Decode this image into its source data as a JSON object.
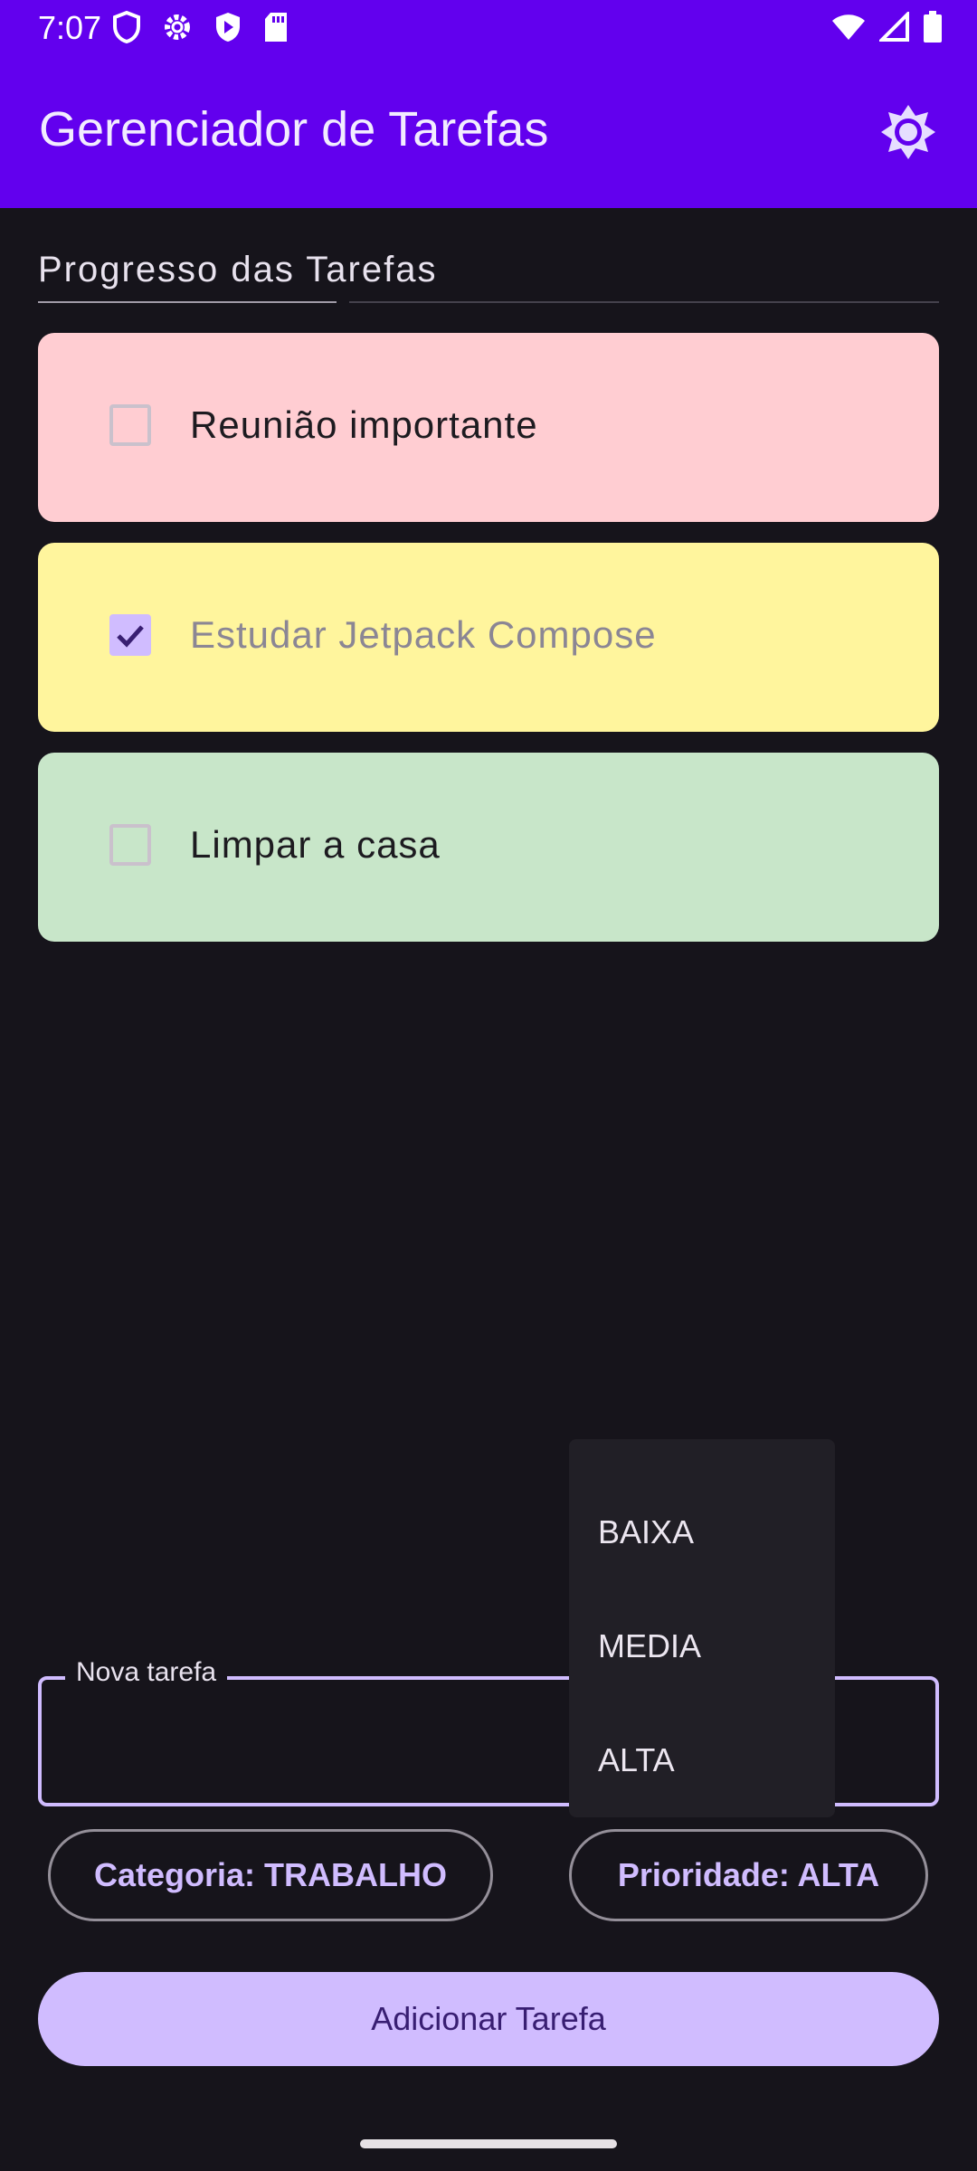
{
  "status_bar": {
    "time": "7:07",
    "icons_left": [
      "shield-icon",
      "gear-icon",
      "play-protect-icon",
      "sd-card-icon"
    ],
    "icons_right": [
      "wifi-icon",
      "signal-icon",
      "battery-icon"
    ]
  },
  "app_bar": {
    "title": "Gerenciador de Tarefas",
    "settings_icon": "brightness-icon"
  },
  "progress": {
    "title": "Progresso das Tarefas",
    "value": 0.33
  },
  "tasks": [
    {
      "label": "Reunião importante",
      "checked": false,
      "color": "#ffcdd2"
    },
    {
      "label": "Estudar Jetpack Compose",
      "checked": true,
      "color": "#fff59d"
    },
    {
      "label": "Limpar a casa",
      "checked": false,
      "color": "#c8e6c9"
    }
  ],
  "new_task": {
    "label": "Nova tarefa",
    "value": ""
  },
  "category_button": "Categoria: TRABALHO",
  "priority_button": "Prioridade: ALTA",
  "priority_menu": {
    "options": [
      "BAIXA",
      "MEDIA",
      "ALTA"
    ]
  },
  "add_button": "Adicionar Tarefa",
  "colors": {
    "primary": "#6200ee",
    "accent": "#d0bcff",
    "background": "#16141b"
  }
}
